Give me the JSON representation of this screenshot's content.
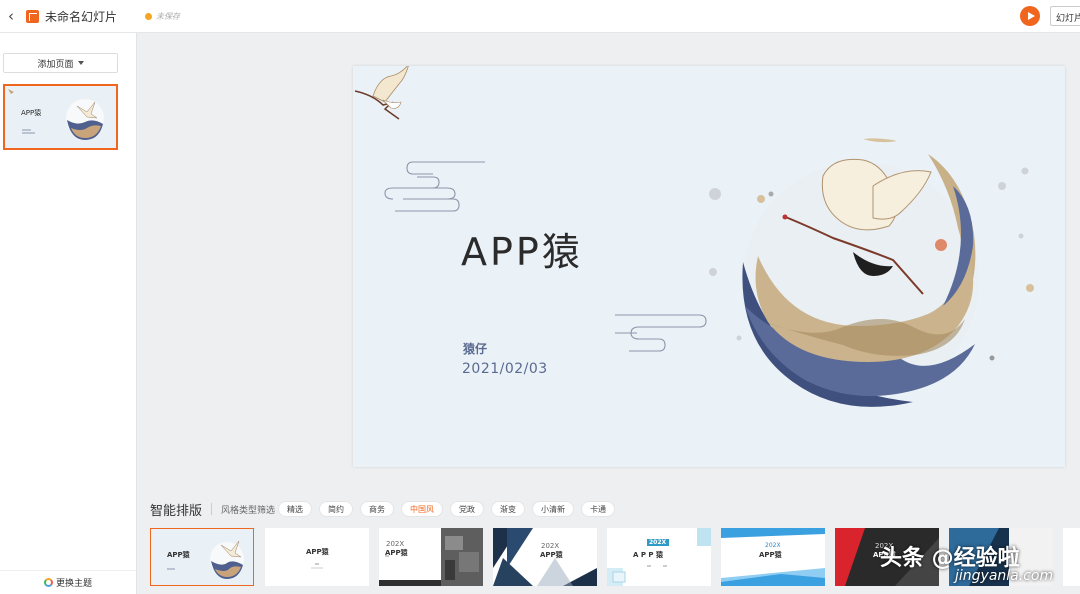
{
  "topbar": {
    "doc_title": "未命名幻灯片",
    "save_status": "未保存",
    "slideshow_label": "幻灯片"
  },
  "left_panel": {
    "add_page_label": "添加页面",
    "change_theme_label": "更换主题",
    "thumbnail": {
      "title": "APP猿"
    }
  },
  "slide": {
    "title": "APP猿",
    "subtitle": "猿仔",
    "date": "2021/02/03",
    "bg_color": "#ebf2f7"
  },
  "smart_layout": {
    "label": "智能排版",
    "filter_label": "风格类型筛选",
    "filters": [
      "精选",
      "简约",
      "商务",
      "中国风",
      "党政",
      "渐变",
      "小清新",
      "卡通"
    ],
    "active_filter": "中国风",
    "layouts": [
      {
        "title": "APP猿"
      },
      {
        "title": "APP猿"
      },
      {
        "year": "202X",
        "title": "APP猿"
      },
      {
        "year": "202X",
        "title": "APP猿"
      },
      {
        "year": "202X",
        "title": "A P P 猿"
      },
      {
        "year": "202X",
        "title": "APP猿"
      },
      {
        "year": "202X",
        "title": "APP猿"
      }
    ]
  },
  "watermark": {
    "text": "头条 @经验啦",
    "url": "jingyanla.com"
  },
  "colors": {
    "accent": "#f0661e",
    "slide_text": "#5a6a90"
  }
}
